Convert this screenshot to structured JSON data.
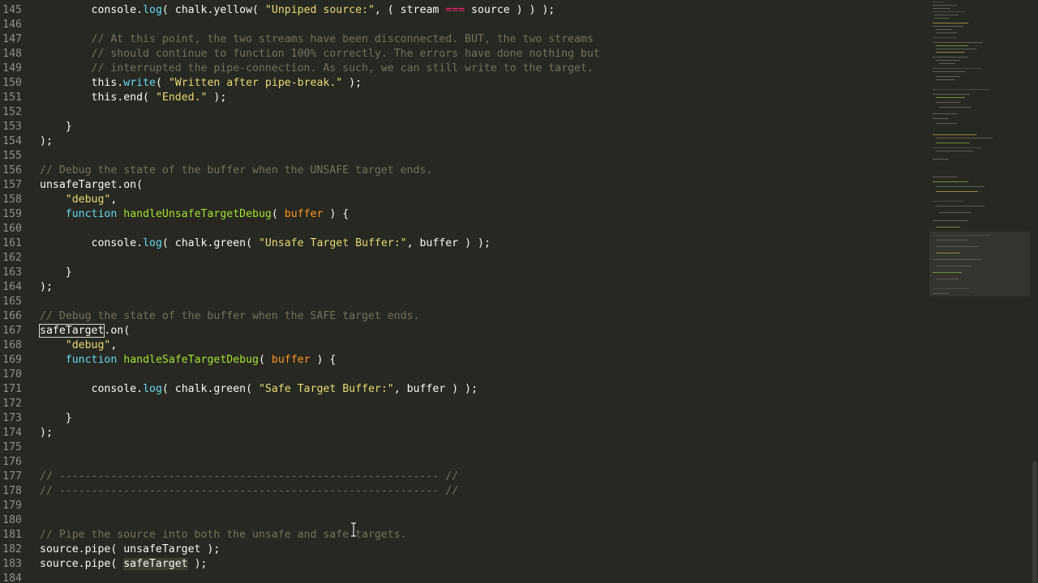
{
  "editor": {
    "lines": [
      {
        "num": "145",
        "tokens": [
          [
            "        ",
            "plain"
          ],
          [
            "console",
            "plain"
          ],
          [
            ".",
            "plain"
          ],
          [
            "log",
            "method"
          ],
          [
            "( chalk.yellow( ",
            "plain"
          ],
          [
            "\"Unpiped source:\"",
            "string"
          ],
          [
            ", ( stream ",
            "plain"
          ],
          [
            "===",
            "op"
          ],
          [
            " source ) ) );",
            "plain"
          ]
        ]
      },
      {
        "num": "146",
        "tokens": []
      },
      {
        "num": "147",
        "tokens": [
          [
            "        ",
            "plain"
          ],
          [
            "// At this point, the two streams have been disconnected. BUT, the two streams",
            "comment"
          ]
        ]
      },
      {
        "num": "148",
        "tokens": [
          [
            "        ",
            "plain"
          ],
          [
            "// should continue to function 100% correctly. The errors have done nothing but",
            "comment"
          ]
        ]
      },
      {
        "num": "149",
        "tokens": [
          [
            "        ",
            "plain"
          ],
          [
            "// interrupted the pipe-connection. As such, we can still write to the target.",
            "comment"
          ]
        ]
      },
      {
        "num": "150",
        "tokens": [
          [
            "        ",
            "plain"
          ],
          [
            "this",
            "plain"
          ],
          [
            ".",
            "plain"
          ],
          [
            "write",
            "method"
          ],
          [
            "( ",
            "plain"
          ],
          [
            "\"Written after pipe-break.\"",
            "string"
          ],
          [
            " );",
            "plain"
          ]
        ]
      },
      {
        "num": "151",
        "tokens": [
          [
            "        ",
            "plain"
          ],
          [
            "this",
            "plain"
          ],
          [
            ".end( ",
            "plain"
          ],
          [
            "\"Ended.\"",
            "string"
          ],
          [
            " );",
            "plain"
          ]
        ]
      },
      {
        "num": "152",
        "tokens": []
      },
      {
        "num": "153",
        "tokens": [
          [
            "    }",
            "plain"
          ]
        ]
      },
      {
        "num": "154",
        "tokens": [
          [
            ");",
            "plain"
          ]
        ]
      },
      {
        "num": "155",
        "tokens": []
      },
      {
        "num": "156",
        "tokens": [
          [
            "// Debug the state of the buffer when the UNSAFE target ends.",
            "comment"
          ]
        ]
      },
      {
        "num": "157",
        "tokens": [
          [
            "unsafeTarget.on(",
            "plain"
          ]
        ]
      },
      {
        "num": "158",
        "tokens": [
          [
            "    ",
            "plain"
          ],
          [
            "\"debug\"",
            "string"
          ],
          [
            ",",
            "plain"
          ]
        ]
      },
      {
        "num": "159",
        "tokens": [
          [
            "    ",
            "plain"
          ],
          [
            "function",
            "keyword"
          ],
          [
            " ",
            "plain"
          ],
          [
            "handleUnsafeTargetDebug",
            "func"
          ],
          [
            "( ",
            "plain"
          ],
          [
            "buffer",
            "param"
          ],
          [
            " ) {",
            "plain"
          ]
        ]
      },
      {
        "num": "160",
        "tokens": []
      },
      {
        "num": "161",
        "tokens": [
          [
            "        ",
            "plain"
          ],
          [
            "console",
            "plain"
          ],
          [
            ".",
            "plain"
          ],
          [
            "log",
            "method"
          ],
          [
            "( chalk.green( ",
            "plain"
          ],
          [
            "\"Unsafe Target Buffer:\"",
            "string"
          ],
          [
            ", buffer ) );",
            "plain"
          ]
        ]
      },
      {
        "num": "162",
        "tokens": []
      },
      {
        "num": "163",
        "tokens": [
          [
            "    }",
            "plain"
          ]
        ]
      },
      {
        "num": "164",
        "tokens": [
          [
            ");",
            "plain"
          ]
        ]
      },
      {
        "num": "165",
        "tokens": []
      },
      {
        "num": "166",
        "tokens": [
          [
            "// Debug the state of the buffer when the SAFE target ends.",
            "comment"
          ]
        ]
      },
      {
        "num": "167",
        "tokens": [
          [
            "safeTarget",
            "boxed"
          ],
          [
            ".on(",
            "plain"
          ]
        ]
      },
      {
        "num": "168",
        "tokens": [
          [
            "    ",
            "plain"
          ],
          [
            "\"debug\"",
            "string"
          ],
          [
            ",",
            "plain"
          ]
        ]
      },
      {
        "num": "169",
        "tokens": [
          [
            "    ",
            "plain"
          ],
          [
            "function",
            "keyword"
          ],
          [
            " ",
            "plain"
          ],
          [
            "handleSafeTargetDebug",
            "func"
          ],
          [
            "( ",
            "plain"
          ],
          [
            "buffer",
            "param"
          ],
          [
            " ) {",
            "plain"
          ]
        ]
      },
      {
        "num": "170",
        "tokens": []
      },
      {
        "num": "171",
        "tokens": [
          [
            "        ",
            "plain"
          ],
          [
            "console",
            "plain"
          ],
          [
            ".",
            "plain"
          ],
          [
            "log",
            "method"
          ],
          [
            "( chalk.green( ",
            "plain"
          ],
          [
            "\"Safe Target Buffer:\"",
            "string"
          ],
          [
            ", buffer ) );",
            "plain"
          ]
        ]
      },
      {
        "num": "172",
        "tokens": []
      },
      {
        "num": "173",
        "tokens": [
          [
            "    }",
            "plain"
          ]
        ]
      },
      {
        "num": "174",
        "tokens": [
          [
            ");",
            "plain"
          ]
        ]
      },
      {
        "num": "175",
        "tokens": []
      },
      {
        "num": "176",
        "tokens": []
      },
      {
        "num": "177",
        "tokens": [
          [
            "// ----------------------------------------------------------- //",
            "comment"
          ]
        ]
      },
      {
        "num": "178",
        "tokens": [
          [
            "// ----------------------------------------------------------- //",
            "comment"
          ]
        ]
      },
      {
        "num": "179",
        "tokens": []
      },
      {
        "num": "180",
        "tokens": []
      },
      {
        "num": "181",
        "tokens": [
          [
            "// Pipe the source into both the unsafe and safe targets.",
            "comment"
          ]
        ]
      },
      {
        "num": "182",
        "tokens": [
          [
            "source.pipe( unsafeTarget );",
            "plain"
          ]
        ]
      },
      {
        "num": "183",
        "tokens": [
          [
            "source.pipe( ",
            "plain"
          ],
          [
            "safeTarget",
            "hl"
          ],
          [
            " );",
            "plain"
          ]
        ]
      },
      {
        "num": "184",
        "tokens": []
      }
    ]
  },
  "minimap": {
    "label": "minimap"
  },
  "cursor": {
    "icon": "text-cursor-icon"
  }
}
